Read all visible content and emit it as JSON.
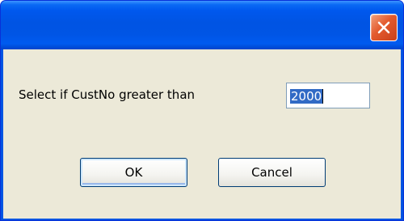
{
  "window": {
    "title": "",
    "close_icon": "close-icon",
    "colors": {
      "titlebar": "#0054e3",
      "close_button": "#e35a2e",
      "client": "#ece9d8",
      "selection": "#316ac5"
    }
  },
  "dialog": {
    "prompt": "Select if CustNo greater than",
    "input_value": "2000",
    "ok_label": "OK",
    "cancel_label": "Cancel"
  }
}
